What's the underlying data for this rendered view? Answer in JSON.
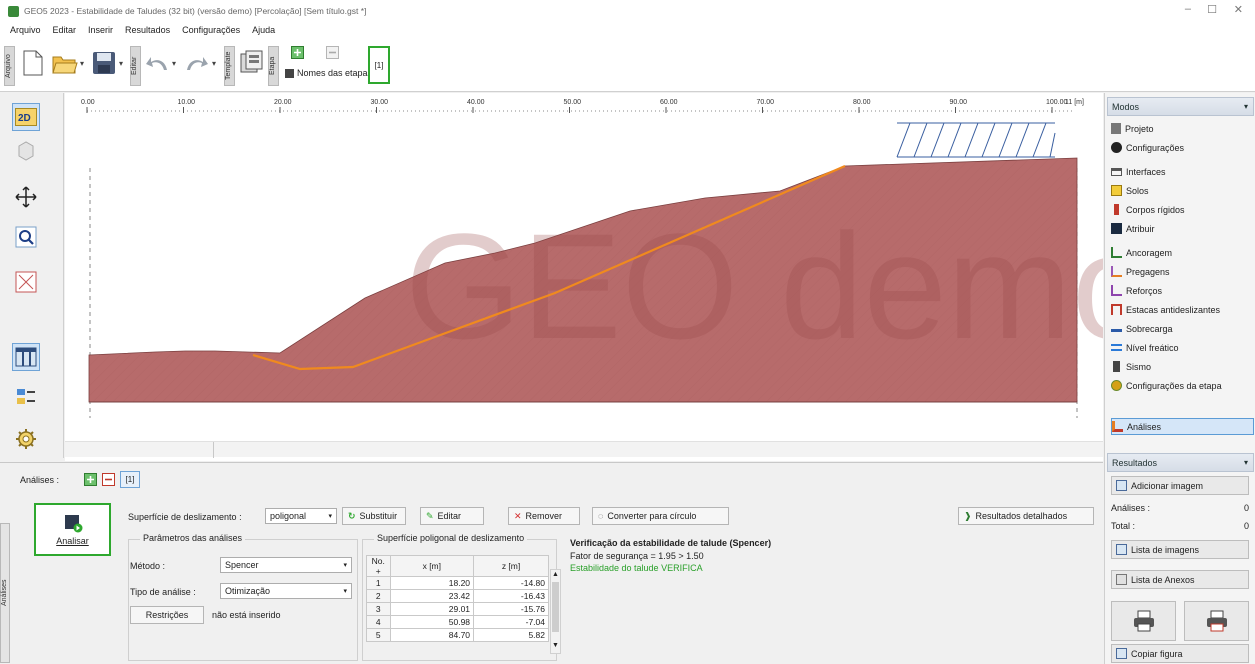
{
  "window": {
    "title": "GEO5 2023 - Estabilidade de Taludes (32 bit) (versão demo) [Percolação] [Sem título.gst *]",
    "minimize": "–",
    "maximize": "☐",
    "close": "✕"
  },
  "menu": [
    "Arquivo",
    "Editar",
    "Inserir",
    "Resultados",
    "Configurações",
    "Ajuda"
  ],
  "toolbar": {
    "tab_arquivo": "Arquivo",
    "tab_editar": "Editar",
    "tab_template": "Template",
    "tab_etapa": "Etapa",
    "stage_names_label": "Nomes das etapas",
    "stage_number": "[1]"
  },
  "ruler": {
    "ticks": [
      "0.00",
      "10.00",
      "20.00",
      "30.00",
      "40.00",
      "50.00",
      "60.00",
      "70.00",
      "80.00",
      "90.00",
      "100.00"
    ],
    "end_label": "11 [m]"
  },
  "watermark": "GEO demo",
  "modes": {
    "header": "Modos",
    "items": [
      {
        "label": "Projeto",
        "icon": "project-icon"
      },
      {
        "label": "Configurações",
        "icon": "settings-dot-icon"
      },
      {
        "label": "Interfaces",
        "icon": "interfaces-icon"
      },
      {
        "label": "Solos",
        "icon": "soils-icon"
      },
      {
        "label": "Corpos rígidos",
        "icon": "rigid-bodies-icon"
      },
      {
        "label": "Atribuir",
        "icon": "assign-icon"
      },
      {
        "label": "Ancoragem",
        "icon": "anchors-icon"
      },
      {
        "label": "Pregagens",
        "icon": "nails-icon"
      },
      {
        "label": "Reforços",
        "icon": "reinforcements-icon"
      },
      {
        "label": "Estacas antideslizantes",
        "icon": "piles-icon"
      },
      {
        "label": "Sobrecarga",
        "icon": "surcharge-icon"
      },
      {
        "label": "Nível freático",
        "icon": "water-table-icon"
      },
      {
        "label": "Sismo",
        "icon": "earthquake-icon"
      },
      {
        "label": "Configurações da etapa",
        "icon": "stage-settings-icon"
      },
      {
        "label": "Análises",
        "icon": "analysis-icon"
      }
    ]
  },
  "results": {
    "header": "Resultados",
    "add_image": "Adicionar imagem",
    "analyses_label": "Análises :",
    "analyses_value": "0",
    "total_label": "Total :",
    "total_value": "0",
    "image_list": "Lista de imagens",
    "annex_list": "Lista de Anexos",
    "copy_figure": "Copiar figura"
  },
  "bottom": {
    "side_tab": "Análises",
    "analyses_label": "Análises :",
    "analysis_index": "[1]",
    "analyse_button": "Analisar",
    "slip_surface_label": "Superfície de deslizamento :",
    "slip_surface_value": "poligonal",
    "replace": "Substituir",
    "edit": "Editar",
    "remove": "Remover",
    "convert": "Converter para círculo",
    "detailed_results": "Resultados detalhados",
    "params_title": "Parâmetros das análises",
    "method_label": "Método :",
    "method_value": "Spencer",
    "analysis_type_label": "Tipo de análise :",
    "analysis_type_value": "Otimização",
    "restrictions_button": "Restrições",
    "restrictions_status": "não está inserido",
    "poly_title": "Superfície poligonal de deslizamento",
    "poly_headers": [
      "No. +",
      "x [m]",
      "z [m]"
    ],
    "poly_rows": [
      [
        "1",
        "18.20",
        "-14.80"
      ],
      [
        "2",
        "23.42",
        "-16.43"
      ],
      [
        "3",
        "29.01",
        "-15.76"
      ],
      [
        "4",
        "50.98",
        "-7.04"
      ],
      [
        "5",
        "84.70",
        "5.82"
      ]
    ],
    "verification_title": "Verificação da estabilidade de talude (Spencer)",
    "safety_factor": "Fator de segurança = 1.95 > 1.50",
    "verdict": "Estabilidade do talude VERIFICA"
  },
  "colors": {
    "soil": "#b76b6b",
    "slip_line": "#f08a1e",
    "verdict": "#2aa02a",
    "selection": "#5b9bd5"
  }
}
